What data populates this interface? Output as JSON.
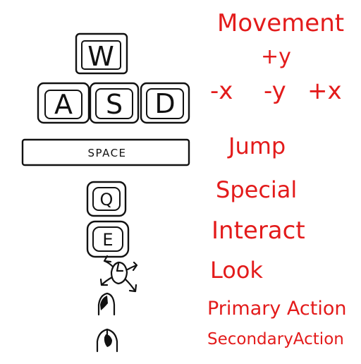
{
  "colors": {
    "ink": "#111111",
    "annotation": "#e31b1b",
    "background": "#ffffff"
  },
  "keys": {
    "w": "W",
    "a": "A",
    "s": "S",
    "d": "D",
    "space": "SPACE",
    "q": "Q",
    "e": "E"
  },
  "icons": {
    "mouse_move": "mouse-move-icon",
    "left_click": "mouse-left-click-icon",
    "right_click": "mouse-right-click-icon"
  },
  "labels": {
    "movement": "Movement",
    "plus_y": "+y",
    "minus_x": "-x",
    "minus_y": "-y",
    "plus_x": "+x",
    "jump": "Jump",
    "special": "Special",
    "interact": "Interact",
    "look": "Look",
    "primary": "Primary Action",
    "secondary": "SecondaryAction"
  }
}
